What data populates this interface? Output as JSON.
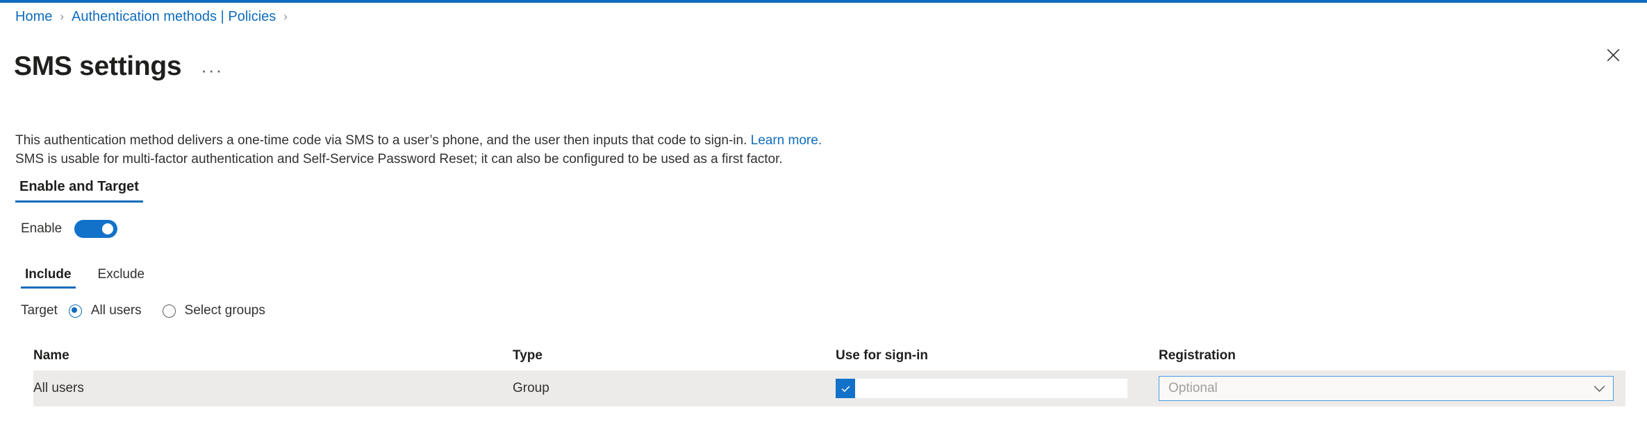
{
  "accent_color": "#0f6cbd",
  "breadcrumb": {
    "items": [
      {
        "label": "Home"
      },
      {
        "label": "Authentication methods | Policies"
      }
    ],
    "separator": "›"
  },
  "header": {
    "title": "SMS settings",
    "more_menu_label": "···",
    "close_icon": "close-icon"
  },
  "description": {
    "line1_before_link": "This authentication method delivers a one-time code via SMS to a user’s phone, and the user then inputs that code to sign-in. ",
    "link_text": "Learn more.",
    "line2": "SMS is usable for multi-factor authentication and Self-Service Password Reset; it can also be configured to be used as a first factor."
  },
  "pivot": {
    "tabs": [
      {
        "label": "Enable and Target",
        "active": true
      }
    ]
  },
  "enable": {
    "label": "Enable",
    "state": "on"
  },
  "subtabs": {
    "tabs": [
      {
        "label": "Include",
        "active": true
      },
      {
        "label": "Exclude",
        "active": false
      }
    ]
  },
  "target": {
    "label": "Target",
    "options": [
      {
        "label": "All users",
        "selected": true
      },
      {
        "label": "Select groups",
        "selected": false
      }
    ]
  },
  "table": {
    "headers": {
      "name": "Name",
      "type": "Type",
      "signin": "Use for sign-in",
      "registration": "Registration"
    },
    "rows": [
      {
        "name": "All users",
        "type": "Group",
        "signin_checked": true,
        "registration_value": "Optional"
      }
    ]
  }
}
